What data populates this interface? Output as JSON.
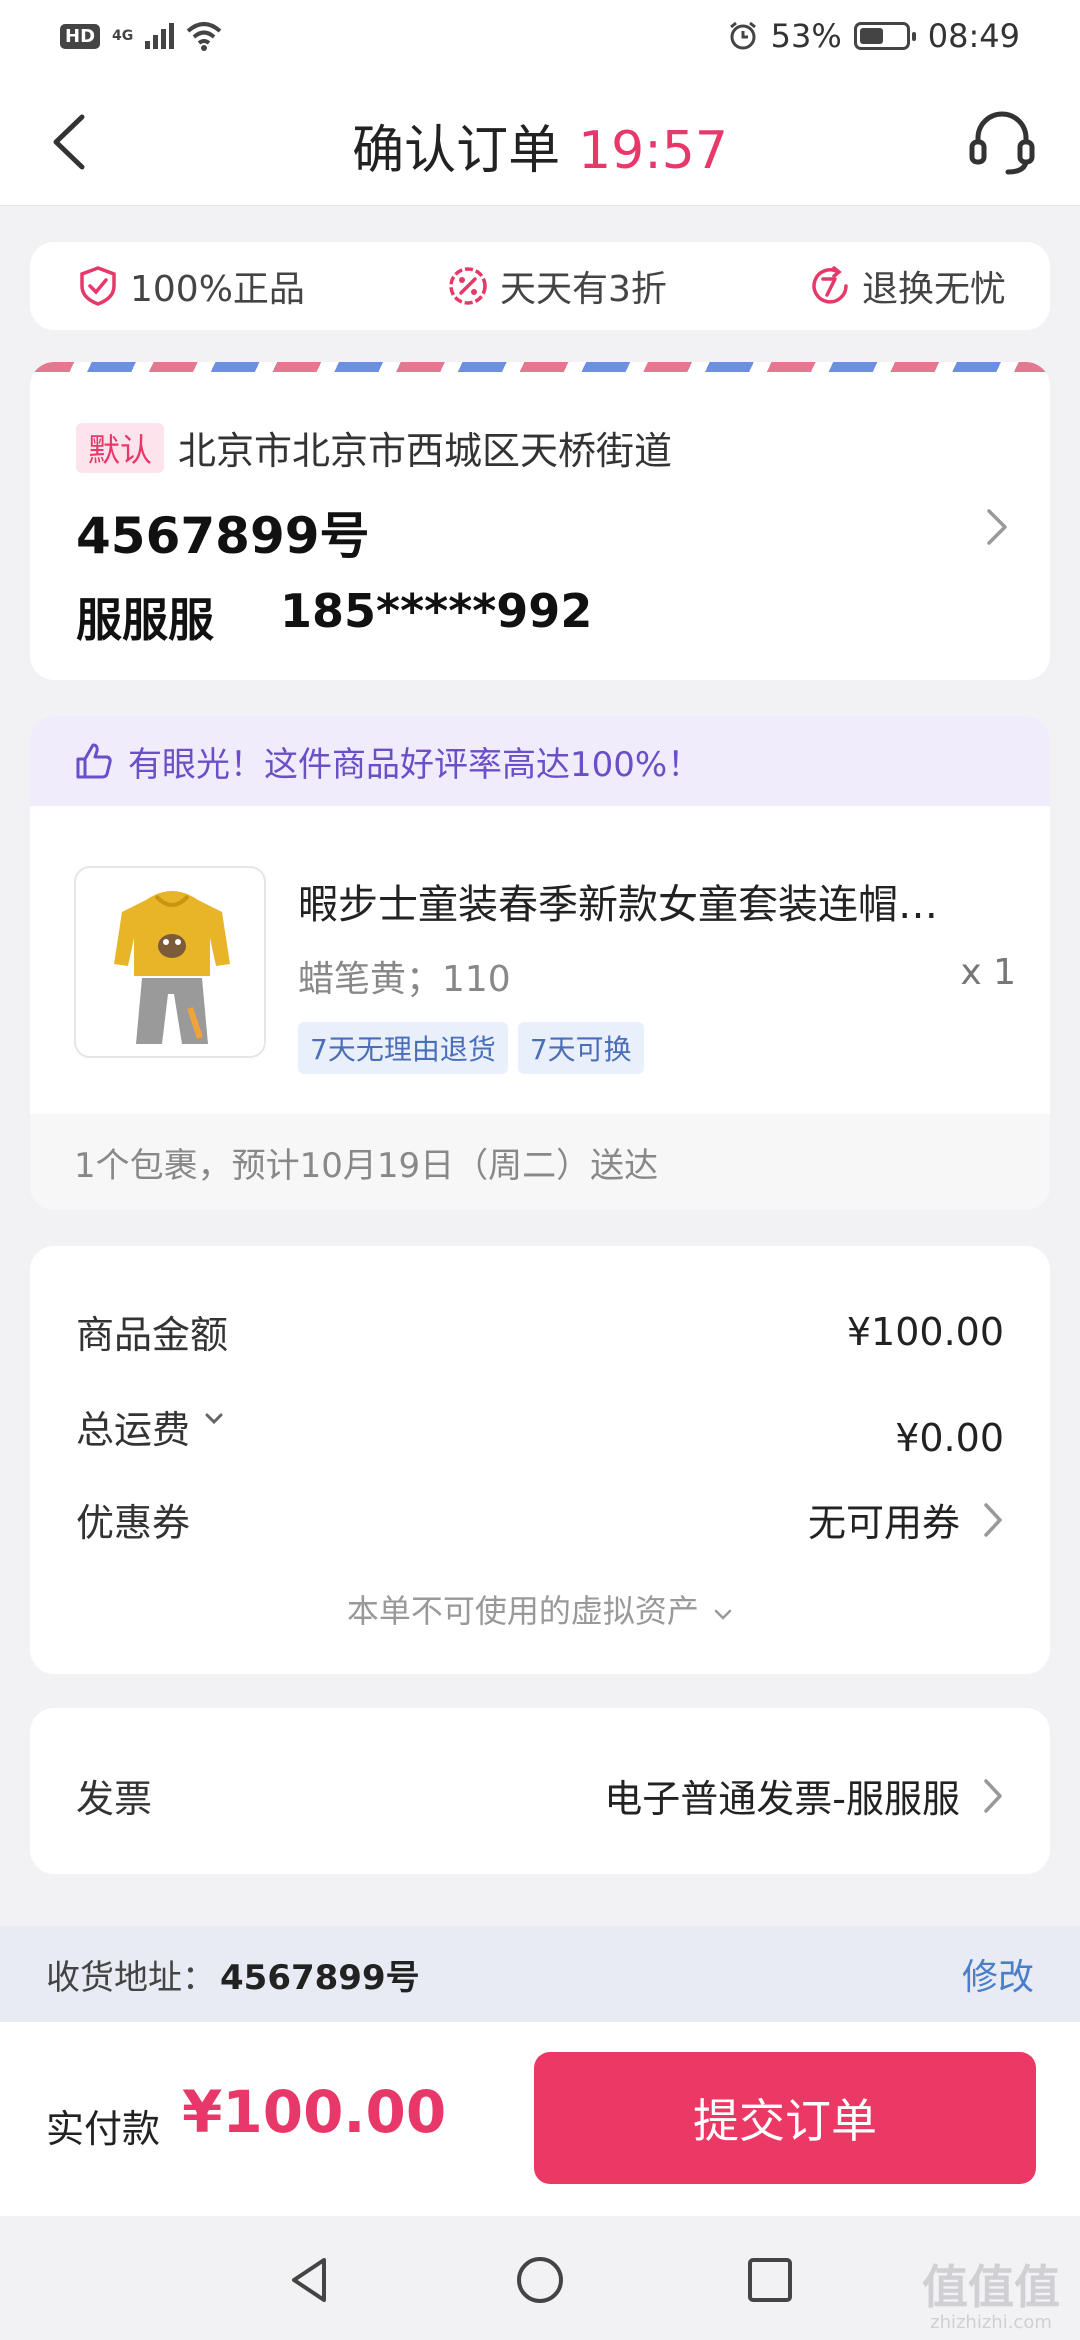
{
  "status_bar": {
    "hd": "HD",
    "network": "4G",
    "battery_percent": "53%",
    "battery_level": 0.53,
    "time": "08:49"
  },
  "header": {
    "title": "确认订单",
    "countdown": "19:57"
  },
  "guarantees": [
    {
      "label": "100%正品",
      "icon": "shield-check-icon"
    },
    {
      "label": "天天有3折",
      "icon": "percent-badge-icon"
    },
    {
      "label": "退换无忧",
      "icon": "return-7-icon"
    }
  ],
  "address": {
    "default_tag": "默认",
    "region": "北京市北京市西城区天桥街道",
    "detail": "4567899号",
    "name": "服服服",
    "phone": "185*****992"
  },
  "order": {
    "praise": "有眼光！这件商品好评率高达100%！",
    "product_title": "暇步士童装春季新款女童套装连帽…",
    "spec": "蜡笔黄；110",
    "quantity": "x 1",
    "tags": [
      "7天无理由退货",
      "7天可换"
    ],
    "delivery": "1个包裹，预计10月19日（周二）送达"
  },
  "price": {
    "goods_label": "商品金额",
    "goods_value": "¥100.00",
    "shipping_label": "总运费",
    "shipping_value": "¥0.00",
    "coupon_label": "优惠券",
    "coupon_value": "无可用券",
    "virtual_note": "本单不可使用的虚拟资产"
  },
  "invoice": {
    "label": "发票",
    "value": "电子普通发票-服服服"
  },
  "bottom_address": {
    "label": "收货地址：",
    "value": "4567899号",
    "modify": "修改"
  },
  "payment": {
    "label": "实付款",
    "amount": "¥100.00",
    "submit": "提交订单"
  },
  "watermark": {
    "main": "值值值",
    "sub": "zhizhizhi.com"
  },
  "colors": {
    "accent": "#e8386a",
    "button": "#ec3864",
    "link": "#4a7fc8",
    "praise": "#6b4fc8"
  }
}
